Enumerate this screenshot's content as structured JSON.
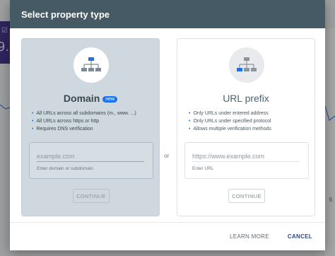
{
  "background": {
    "metric_value": "9.",
    "side_text": "9."
  },
  "dialog": {
    "title": "Select property type",
    "or_label": "or",
    "domain": {
      "title": "Domain",
      "badge": "new",
      "icon": "sitemap-icon",
      "features": [
        "All URLs across all subdomains (m., www. ...)",
        "All URLs across https or http",
        "Requires DNS verification"
      ],
      "input_placeholder": "example.com",
      "input_value": "",
      "helper": "Enter domain or subdomain",
      "continue_label": "CONTINUE"
    },
    "url_prefix": {
      "title": "URL prefix",
      "icon": "sitemap-icon",
      "features": [
        "Only URLs under entered address",
        "Only URLs under specified protocol",
        "Allows multiple verification methods"
      ],
      "input_placeholder": "https://www.example.com",
      "input_value": "",
      "helper": "Enter URL",
      "continue_label": "CONTINUE"
    },
    "footer": {
      "learn_more_label": "LEARN MORE",
      "cancel_label": "CANCEL"
    }
  },
  "colors": {
    "header_bg": "#455a64",
    "accent": "#1a73e8",
    "domain_card_bg": "#cfd8df"
  }
}
